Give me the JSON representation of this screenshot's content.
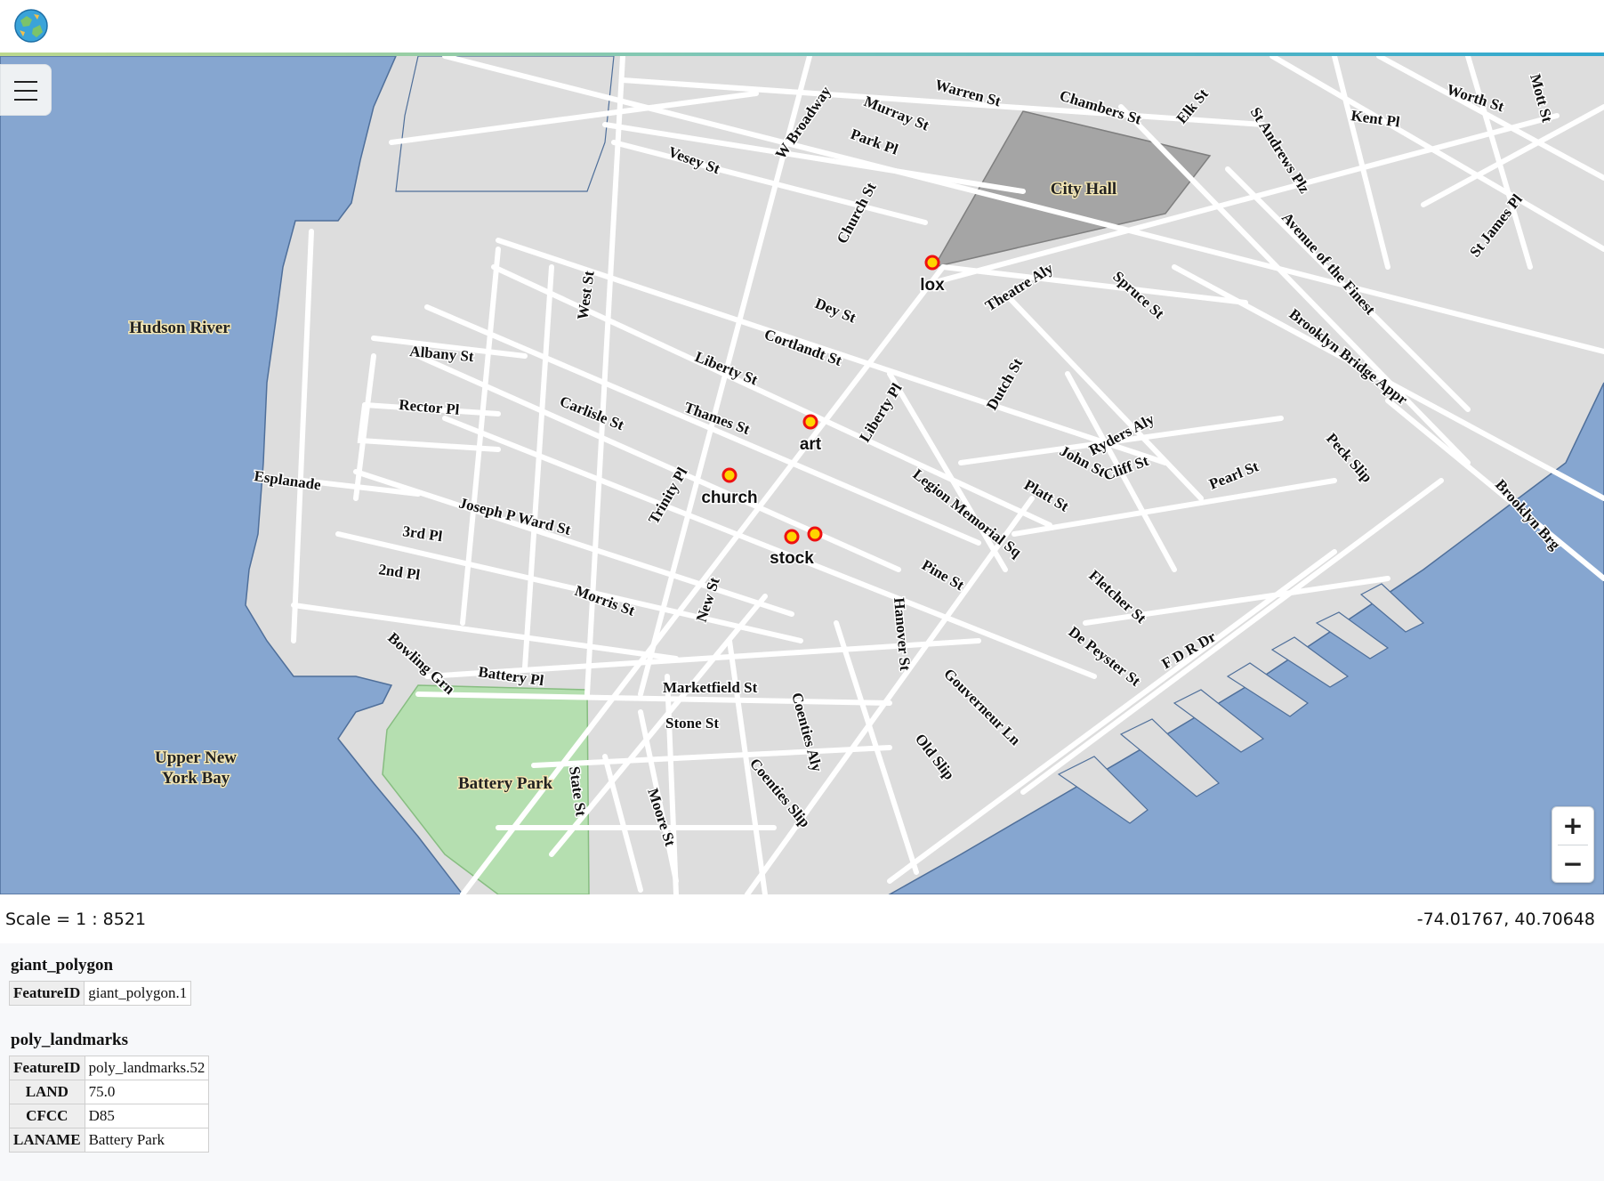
{
  "app": {
    "logo_icon": "globe-icon"
  },
  "map": {
    "colors": {
      "water": "#86a6d0",
      "land": "#dddddd",
      "road": "#ffffff",
      "park": "#b5dfb0",
      "city_hall": "#a5a5a5",
      "poi_fill": "#ffd500",
      "poi_ring": "#ee1111"
    },
    "areas": {
      "city_hall": "City Hall",
      "battery_park": "Battery Park"
    },
    "water_labels": {
      "hudson": "Hudson River",
      "bay_line1": "Upper New",
      "bay_line2": "York Bay"
    },
    "streets": [
      "Warren St",
      "Chambers St",
      "Elk St",
      "St Andrews Plz",
      "Kent Pl",
      "Worth St",
      "Mott St",
      "Murray St",
      "W Broadway",
      "Park Pl",
      "Vesey St",
      "Church St",
      "Avenue of the Finest",
      "St James Pl",
      "Spruce St",
      "Theatre Aly",
      "Dey St",
      "West St",
      "Cortlandt St",
      "Brooklyn Bridge Appr",
      "Albany St",
      "Liberty St",
      "Dutch St",
      "Rector Pl",
      "Carlisle St",
      "Thames St",
      "Liberty Pl",
      "Ryders Aly",
      "John St",
      "Cliff St",
      "Peck Slip",
      "Esplanade",
      "Trinity Pl",
      "Pearl St",
      "Platt St",
      "Legion Memorial Sq",
      "Brooklyn Brg",
      "Joseph P Ward St",
      "3rd Pl",
      "2nd Pl",
      "Pine St",
      "Fletcher St",
      "Morris St",
      "New St",
      "Hanover St",
      "De Peyster St",
      "F D R Dr",
      "Bowling Grn",
      "Battery Pl",
      "Marketfield St",
      "Gouverneur Ln",
      "Stone St",
      "Coenties Aly",
      "Old Slip",
      "Coenties Slip",
      "State St",
      "Moore St"
    ],
    "pois": [
      {
        "label": "lox"
      },
      {
        "label": "art"
      },
      {
        "label": "church"
      },
      {
        "label": "stock"
      }
    ],
    "zoom": {
      "in_label": "+",
      "out_label": "−"
    }
  },
  "status": {
    "scale": "Scale = 1 : 8521",
    "coordinates": "-74.01767, 40.70648"
  },
  "layers": [
    {
      "name": "giant_polygon",
      "rows": [
        {
          "key": "FeatureID",
          "value": "giant_polygon.1"
        }
      ]
    },
    {
      "name": "poly_landmarks",
      "rows": [
        {
          "key": "FeatureID",
          "value": "poly_landmarks.52"
        },
        {
          "key": "LAND",
          "value": "75.0"
        },
        {
          "key": "CFCC",
          "value": "D85"
        },
        {
          "key": "LANAME",
          "value": "Battery Park"
        }
      ]
    }
  ]
}
